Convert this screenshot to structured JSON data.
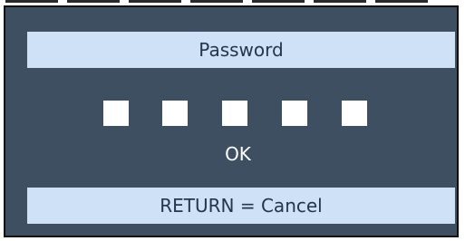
{
  "dialog": {
    "title": "Password",
    "ok_label": "OK",
    "cancel_hint": "RETURN = Cancel",
    "password_slots": 5
  },
  "colors": {
    "panel_bg": "#3d4f60",
    "bar_bg": "#cfe1f7",
    "bar_text": "#23364a",
    "text_light": "#ffffff"
  }
}
